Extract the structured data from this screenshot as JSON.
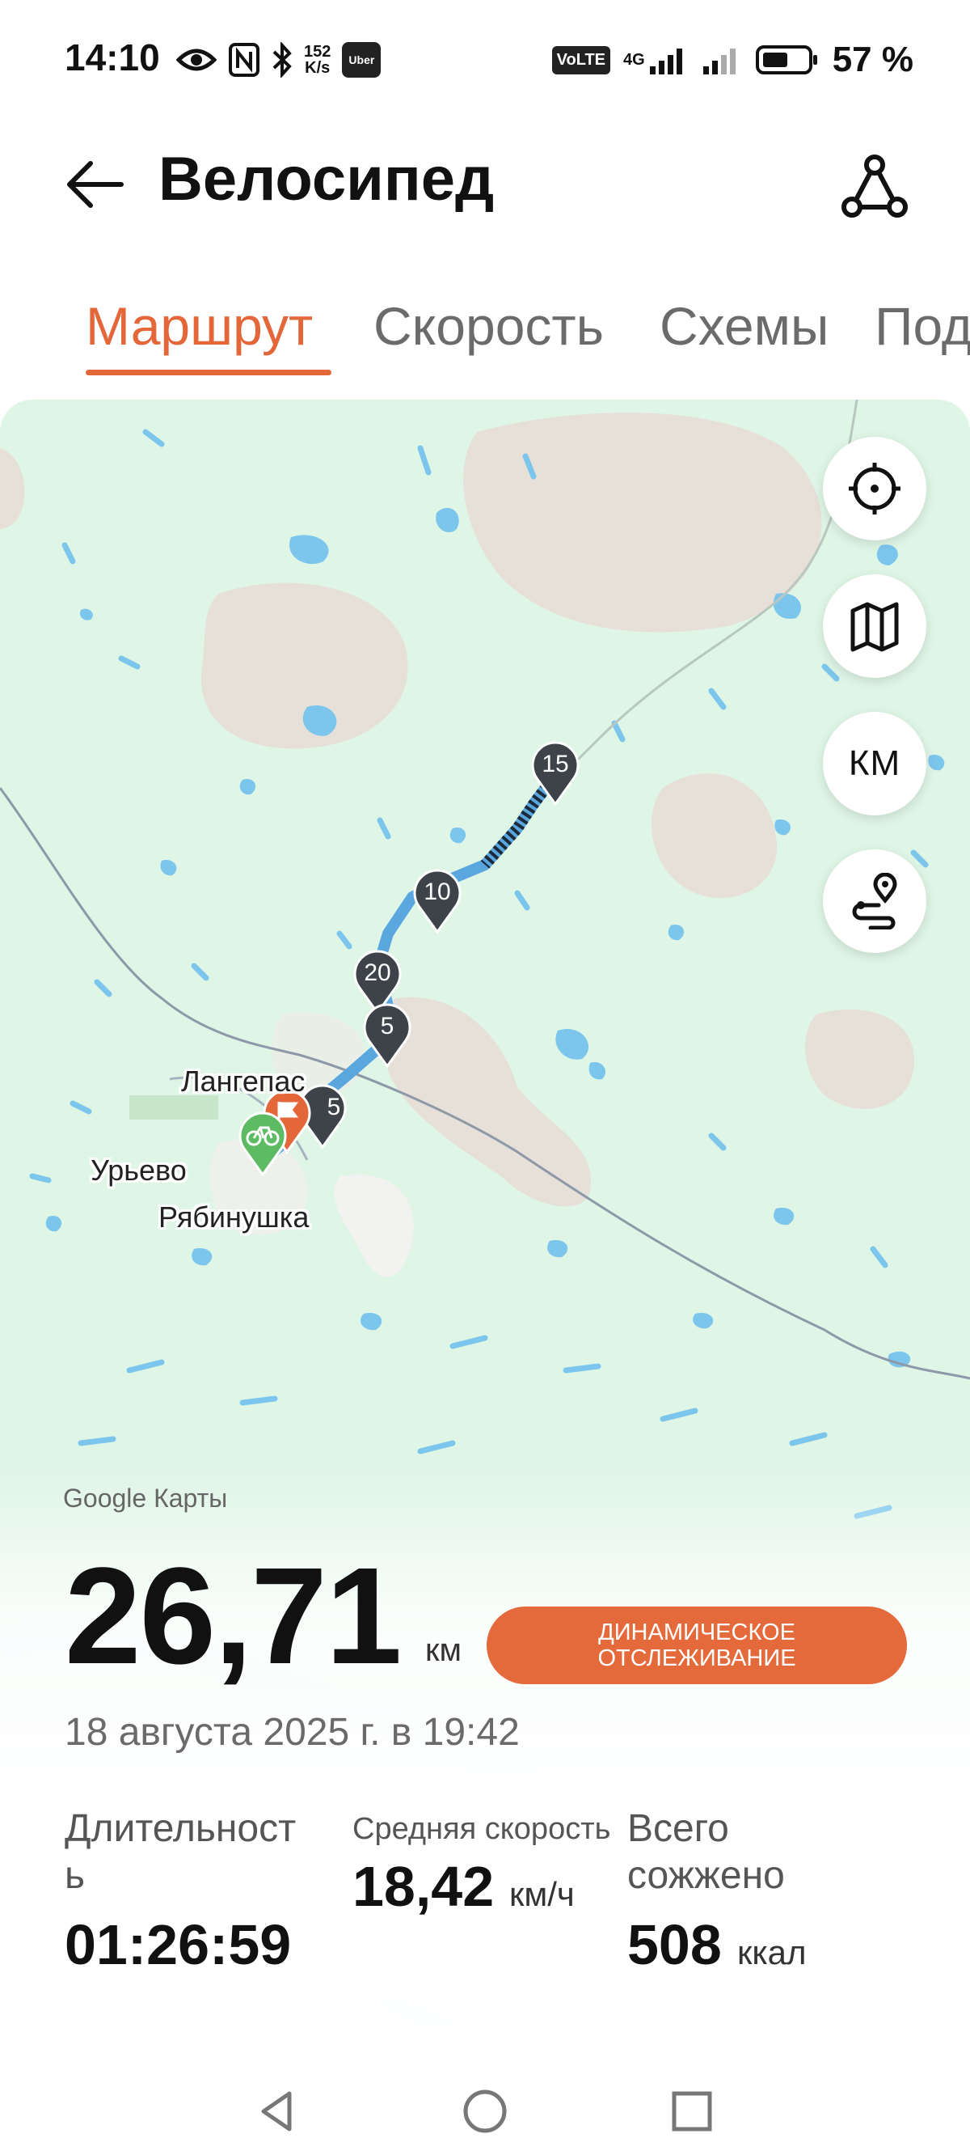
{
  "status_bar": {
    "time": "14:10",
    "net_speed_value": "152",
    "net_speed_unit": "K/s",
    "uber_label": "Uber",
    "volte_label": "VoLTE",
    "network_label": "4G",
    "battery_percent": "57 %",
    "icons": [
      "eye-icon",
      "nfc-icon",
      "bluetooth-icon",
      "signal-icon",
      "battery-icon"
    ]
  },
  "header": {
    "title": "Велосипед"
  },
  "tabs": [
    {
      "label": "Маршрут",
      "active": true
    },
    {
      "label": "Скорость",
      "active": false
    },
    {
      "label": "Схемы",
      "active": false
    },
    {
      "label": "Под",
      "active": false
    }
  ],
  "map": {
    "markers": [
      "15",
      "10",
      "20",
      "5",
      "5"
    ],
    "places": [
      "Лангепас",
      "Урьево",
      "Рябинушка"
    ],
    "attribution": "Google Карты",
    "controls": {
      "units_label": "КМ"
    }
  },
  "summary": {
    "distance": "26,71",
    "distance_unit": "км",
    "live_tracking_line1": "ДИНАМИЧЕСКОЕ",
    "live_tracking_line2": "ОТСЛЕЖИВАНИЕ",
    "date": "18 августа 2025 г. в 19:42",
    "duration_label_line1": "Длительност",
    "duration_label_line2": "ь",
    "duration_value": "01:26:59",
    "avg_speed_label": "Средняя скорость",
    "avg_speed_value": "18,42",
    "avg_speed_unit": "км/ч",
    "calories_label_line1": "Всего",
    "calories_label_line2": "сожжено",
    "calories_value": "508",
    "calories_unit": "ккал"
  },
  "colors": {
    "accent": "#e4673a",
    "map_land": "#dff5e6",
    "water": "#7cc6ee",
    "route": "#5aa7df"
  }
}
